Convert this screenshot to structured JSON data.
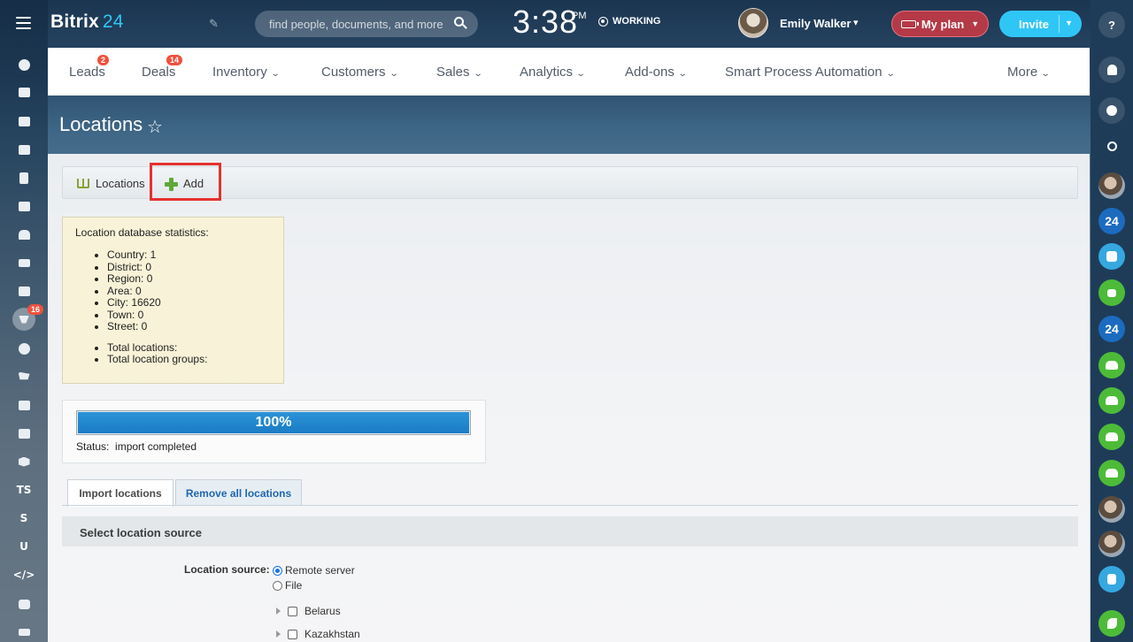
{
  "header": {
    "logo_text": "Bitrix",
    "logo_number": "24",
    "search_placeholder": "find people, documents, and more",
    "clock": "3:38",
    "clock_ampm": "PM",
    "work_status": "WORKING",
    "user_name": "Emily Walker",
    "myplan_label": "My plan",
    "invite_label": "Invite"
  },
  "left_bar": {
    "badge_count": "16",
    "text_items": [
      "TS",
      "S",
      "U"
    ]
  },
  "menu": {
    "items": [
      {
        "label": "Leads",
        "badge": "2"
      },
      {
        "label": "Deals",
        "badge": "14"
      },
      {
        "label": "Inventory"
      },
      {
        "label": "Customers"
      },
      {
        "label": "Sales"
      },
      {
        "label": "Analytics"
      },
      {
        "label": "Add-ons"
      },
      {
        "label": "Smart Process Automation"
      },
      {
        "label": "More"
      }
    ]
  },
  "page": {
    "title": "Locations"
  },
  "toolbar": {
    "locations_label": "Locations",
    "add_label": "Add"
  },
  "stats": {
    "heading": "Location database statistics:",
    "rows": [
      "Country: 1",
      "District: 0",
      "Region: 0",
      "Area: 0",
      "City: 16620",
      "Town: 0",
      "Street: 0"
    ],
    "totals": [
      "Total locations:",
      "Total location groups:"
    ]
  },
  "progress": {
    "percent_label": "100%",
    "value": 1.0,
    "status_label": "Status:",
    "status_value": "import completed"
  },
  "tabs": {
    "import_label": "Import locations",
    "remove_label": "Remove all locations"
  },
  "form": {
    "section_title": "Select location source",
    "source_label": "Location source:",
    "options": [
      "Remote server",
      "File"
    ],
    "selected_option": "Remote server",
    "countries": [
      "Belarus",
      "Kazakhstan"
    ]
  },
  "right_bar": {
    "badge_labels": [
      "24",
      "24"
    ]
  },
  "colors": {
    "accent": "#2fc6f6",
    "myplan": "#b53a48",
    "progress": "#1b7cc4",
    "highlight": "#e5312f",
    "badge": "#f0503c"
  }
}
